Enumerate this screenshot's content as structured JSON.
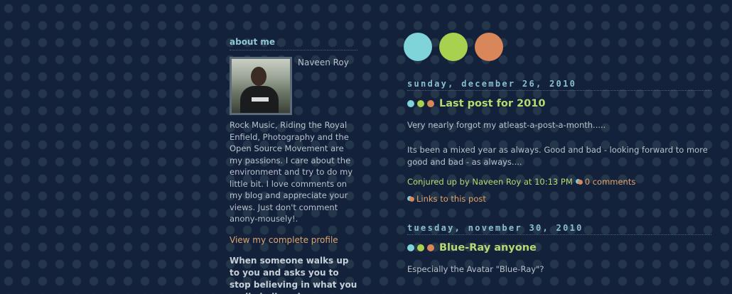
{
  "sidebar": {
    "title": "about me",
    "profile_name": "Naveen Roy",
    "about_text": "Rock Music, Riding the Royal Enfield, Photography and the Open Source Movement are my passions. I care about the environment and try to do my little bit. I love comments on my blog and appreciate your views. Just don't comment anony-mousely!.",
    "profile_link": "View my complete profile",
    "quote": "When someone walks up to you and asks you to stop believing in what you really believe in"
  },
  "colors": {
    "background": "#13223a",
    "dot_blue": "#7fd4d9",
    "dot_green": "#a9d150",
    "dot_orange": "#d9865b",
    "title_green": "#b6d972",
    "link_orange": "#e0a56e",
    "header_blue": "#89bfd1"
  },
  "posts": [
    {
      "date": "sunday, december 26, 2010",
      "title": "Last post for 2010",
      "paragraphs": [
        "Very nearly forgot my atleast-a-post-a-month.....",
        "Its been a mixed year as always. Good and bad - looking forward to more good and bad - as always...."
      ],
      "footer_prefix": "Conjured up by Naveen Roy at 10:13 PM",
      "comments_label": "0 comments",
      "links_label": "Links to this post"
    },
    {
      "date": "tuesday, november 30, 2010",
      "title": "Blue-Ray anyone",
      "paragraphs": [
        "Especially the Avatar \"Blue-Ray\"?"
      ]
    }
  ]
}
